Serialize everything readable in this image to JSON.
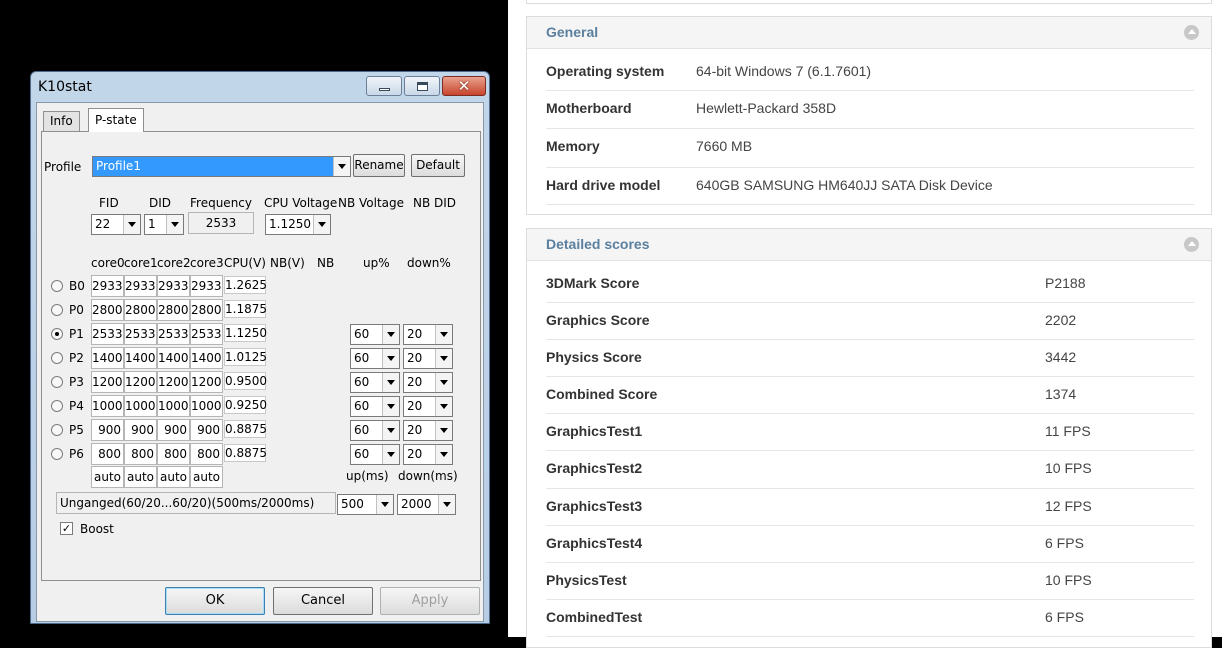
{
  "k10stat": {
    "title": "K10stat",
    "close_glyph": "✕",
    "tabs": [
      "Info",
      "P-state"
    ],
    "profile_label": "Profile",
    "profile_value": "Profile1",
    "rename_label": "Rename",
    "default_label": "Default",
    "headers": {
      "fid": "FID",
      "did": "DID",
      "frequency": "Frequency",
      "cpu_voltage": "CPU Voltage",
      "nb_voltage": "NB Voltage",
      "nb_did": "NB DID"
    },
    "fid_value": "22",
    "did_value": "1",
    "frequency_value": "2533",
    "cpu_voltage_value": "1.1250",
    "col_headers": [
      "core0",
      "core1",
      "core2",
      "core3",
      "CPU(V)",
      "NB(V)",
      "NB",
      "up%",
      "down%"
    ],
    "pstates": [
      {
        "label": "B0",
        "cores": [
          "2933",
          "2933",
          "2933",
          "2933"
        ],
        "cpu_v": "1.2625",
        "up": "",
        "down": ""
      },
      {
        "label": "P0",
        "cores": [
          "2800",
          "2800",
          "2800",
          "2800"
        ],
        "cpu_v": "1.1875",
        "up": "",
        "down": ""
      },
      {
        "label": "P1",
        "cores": [
          "2533",
          "2533",
          "2533",
          "2533"
        ],
        "cpu_v": "1.1250",
        "up": "60",
        "down": "20"
      },
      {
        "label": "P2",
        "cores": [
          "1400",
          "1400",
          "1400",
          "1400"
        ],
        "cpu_v": "1.0125",
        "up": "60",
        "down": "20"
      },
      {
        "label": "P3",
        "cores": [
          "1200",
          "1200",
          "1200",
          "1200"
        ],
        "cpu_v": "0.9500",
        "up": "60",
        "down": "20"
      },
      {
        "label": "P4",
        "cores": [
          "1000",
          "1000",
          "1000",
          "1000"
        ],
        "cpu_v": "0.9250",
        "up": "60",
        "down": "20"
      },
      {
        "label": "P5",
        "cores": [
          "900",
          "900",
          "900",
          "900"
        ],
        "cpu_v": "0.8875",
        "up": "60",
        "down": "20"
      },
      {
        "label": "P6",
        "cores": [
          "800",
          "800",
          "800",
          "800"
        ],
        "cpu_v": "0.8875",
        "up": "60",
        "down": "20"
      }
    ],
    "selected_pstate": "P1",
    "auto_labels": [
      "auto",
      "auto",
      "auto",
      "auto"
    ],
    "up_ms_label": "up(ms)",
    "down_ms_label": "down(ms)",
    "ganged_text": "Unganged(60/20...60/20)(500ms/2000ms)",
    "up_ms_value": "500",
    "down_ms_value": "2000",
    "boost_label": "Boost",
    "boost_checked": "✓",
    "ok_label": "OK",
    "cancel_label": "Cancel",
    "apply_label": "Apply"
  },
  "general": {
    "title": "General",
    "rows": [
      {
        "key": "Operating system",
        "value": "64-bit Windows 7 (6.1.7601)"
      },
      {
        "key": "Motherboard",
        "value": "Hewlett-Packard 358D"
      },
      {
        "key": "Memory",
        "value": "7660 MB"
      },
      {
        "key": "Hard drive model",
        "value": "640GB SAMSUNG HM640JJ SATA Disk Device"
      }
    ]
  },
  "detailed": {
    "title": "Detailed scores",
    "rows": [
      {
        "key": "3DMark Score",
        "value": "P2188"
      },
      {
        "key": "Graphics Score",
        "value": "2202"
      },
      {
        "key": "Physics Score",
        "value": "3442"
      },
      {
        "key": "Combined Score",
        "value": "1374"
      },
      {
        "key": "GraphicsTest1",
        "value": "11 FPS"
      },
      {
        "key": "GraphicsTest2",
        "value": "10 FPS"
      },
      {
        "key": "GraphicsTest3",
        "value": "12 FPS"
      },
      {
        "key": "GraphicsTest4",
        "value": "6 FPS"
      },
      {
        "key": "PhysicsTest",
        "value": "10 FPS"
      },
      {
        "key": "CombinedTest",
        "value": "6 FPS"
      }
    ]
  }
}
